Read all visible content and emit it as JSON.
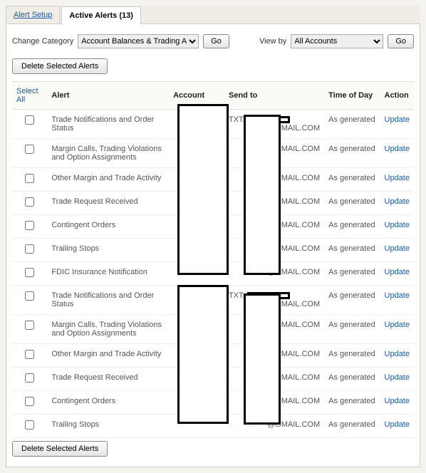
{
  "tabs": {
    "setup": "Alert Setup",
    "active": "Active Alerts (13)"
  },
  "controls": {
    "changeCategoryLabel": "Change Category",
    "categoryValue": "Account Balances & Trading Activity",
    "goLabel": "Go",
    "viewByLabel": "View by",
    "viewByValue": "All Accounts"
  },
  "deleteLabel": "Delete Selected Alerts",
  "headers": {
    "selectAll": "Select All",
    "alert": "Alert",
    "account": "Account",
    "sendTo": "Send to",
    "time": "Time of Day",
    "action": "Action"
  },
  "txtPrefix": "TXT:",
  "emailSuffix": "@GMAIL.COM",
  "asGenerated": "As generated",
  "updateLabel": "Update",
  "rows": [
    {
      "alert": "Trade Notifications and Order Status",
      "showTxt": true
    },
    {
      "alert": "Margin Calls, Trading Violations and Option Assignments",
      "showTxt": false
    },
    {
      "alert": "Other Margin and Trade Activity",
      "showTxt": false
    },
    {
      "alert": "Trade Request Received",
      "showTxt": false
    },
    {
      "alert": "Contingent Orders",
      "showTxt": false
    },
    {
      "alert": "Trailing Stops",
      "showTxt": false
    },
    {
      "alert": "FDIC Insurance Notification",
      "showTxt": false
    },
    {
      "alert": "Trade Notifications and Order Status",
      "showTxt": true
    },
    {
      "alert": "Margin Calls, Trading Violations and Option Assignments",
      "showTxt": false
    },
    {
      "alert": "Other Margin and Trade Activity",
      "showTxt": false
    },
    {
      "alert": "Trade Request Received",
      "showTxt": false
    },
    {
      "alert": "Contingent Orders",
      "showTxt": false
    },
    {
      "alert": "Trailing Stops",
      "showTxt": false
    }
  ]
}
